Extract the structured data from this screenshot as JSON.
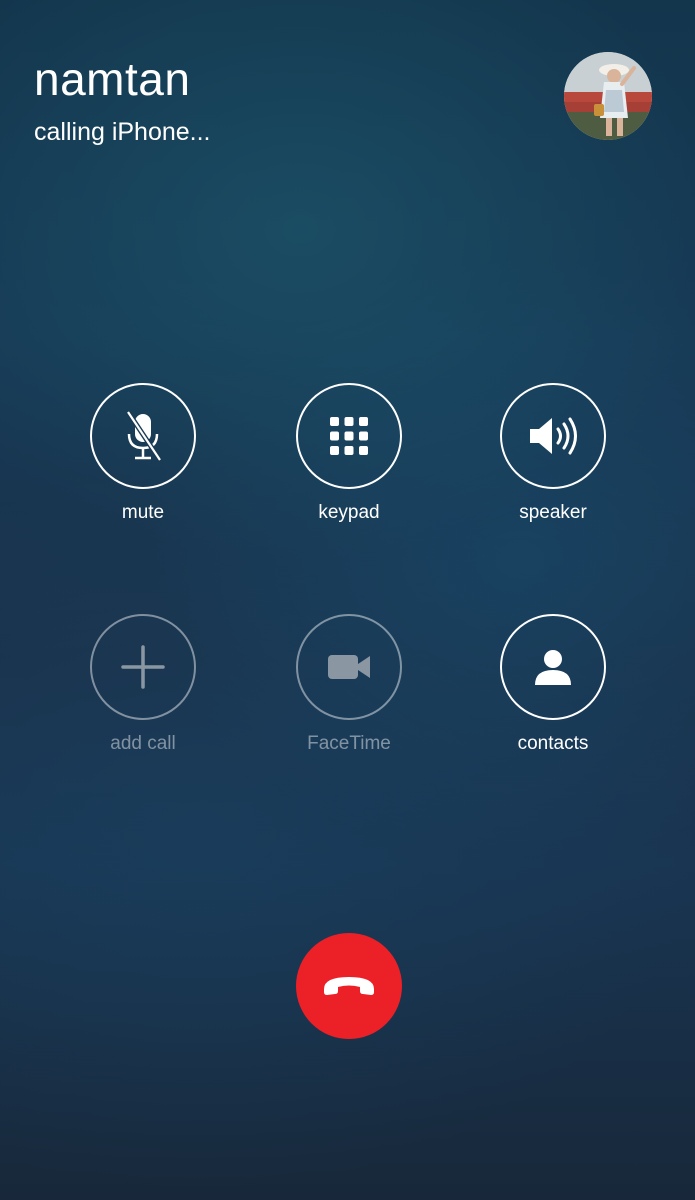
{
  "caller": {
    "name": "namtan",
    "status": "calling iPhone..."
  },
  "controls": {
    "mute": {
      "label": "mute",
      "icon": "muted-microphone-icon",
      "enabled": true
    },
    "keypad": {
      "label": "keypad",
      "icon": "keypad-grid-icon",
      "enabled": true
    },
    "speaker": {
      "label": "speaker",
      "icon": "speaker-icon",
      "enabled": true
    },
    "add_call": {
      "label": "add call",
      "icon": "plus-icon",
      "enabled": false
    },
    "facetime": {
      "label": "FaceTime",
      "icon": "video-camera-icon",
      "enabled": false
    },
    "contacts": {
      "label": "contacts",
      "icon": "person-icon",
      "enabled": true
    }
  },
  "end_call": {
    "icon": "hang-up-icon"
  },
  "colors": {
    "end_call_red": "#ec2027",
    "text_white": "#ffffff",
    "disabled_gray": "#8a97a3",
    "background_top": "#13364d",
    "background_bottom": "#18283a"
  }
}
